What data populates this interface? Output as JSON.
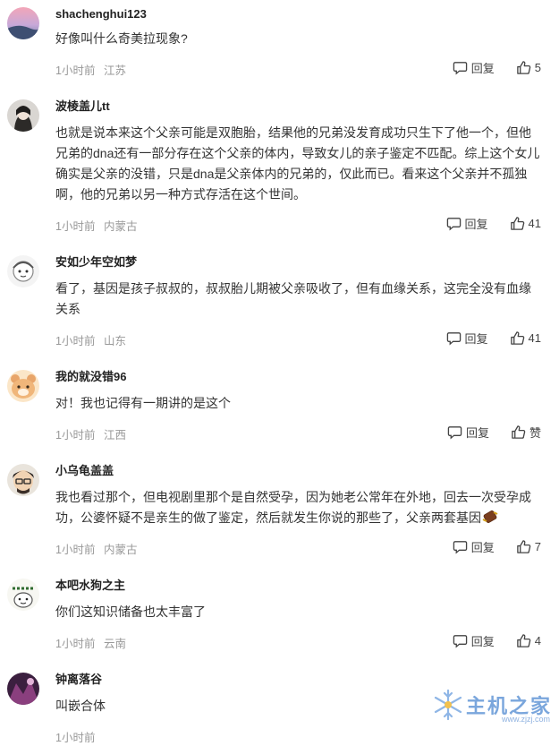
{
  "comments": [
    {
      "user": "shachenghui123",
      "text": "好像叫什么奇美拉现象?",
      "time": "1小时前",
      "location": "江苏",
      "reply": "回复",
      "likes": "5"
    },
    {
      "user": "波棱盖儿tt",
      "text": "也就是说本来这个父亲可能是双胞胎，结果他的兄弟没发育成功只生下了他一个，但他兄弟的dna还有一部分存在这个父亲的体内，导致女儿的亲子鉴定不匹配。综上这个女儿确实是父亲的没错，只是dna是父亲体内的兄弟的，仅此而已。看来这个父亲并不孤独啊，他的兄弟以另一种方式存活在这个世间。",
      "time": "1小时前",
      "location": "内蒙古",
      "reply": "回复",
      "likes": "41"
    },
    {
      "user": "安如少年空如梦",
      "text": "看了，基因是孩子叔叔的，叔叔胎儿期被父亲吸收了，但有血缘关系，这完全没有血缘关系",
      "time": "1小时前",
      "location": "山东",
      "reply": "回复",
      "likes": "41"
    },
    {
      "user": "我的就没错96",
      "text": "对！我也记得有一期讲的是这个",
      "time": "1小时前",
      "location": "江西",
      "reply": "回复",
      "likes": "赞"
    },
    {
      "user": "小乌龟盖盖",
      "text": "我也看过那个，但电视剧里那个是自然受孕，因为她老公常年在外地，回去一次受孕成功，公婆怀疑不是亲生的做了鉴定，然后就发生你说的那些了，父亲两套基因",
      "time": "1小时前",
      "location": "内蒙古",
      "reply": "回复",
      "likes": "7"
    },
    {
      "user": "本吧水狗之主",
      "text": "你们这知识储备也太丰富了",
      "time": "1小时前",
      "location": "云南",
      "reply": "回复",
      "likes": "4"
    },
    {
      "user": "钟离落谷",
      "text": "叫嵌合体",
      "time": "1小时前",
      "location": "",
      "reply": "",
      "likes": ""
    }
  ],
  "watermark": {
    "text": "主机之家",
    "url": "www.zjzj.com"
  },
  "icons": {
    "reply": "comment-bubble-icon",
    "like": "thumbs-up-icon",
    "emoji": "chocolate-emoji-icon"
  }
}
